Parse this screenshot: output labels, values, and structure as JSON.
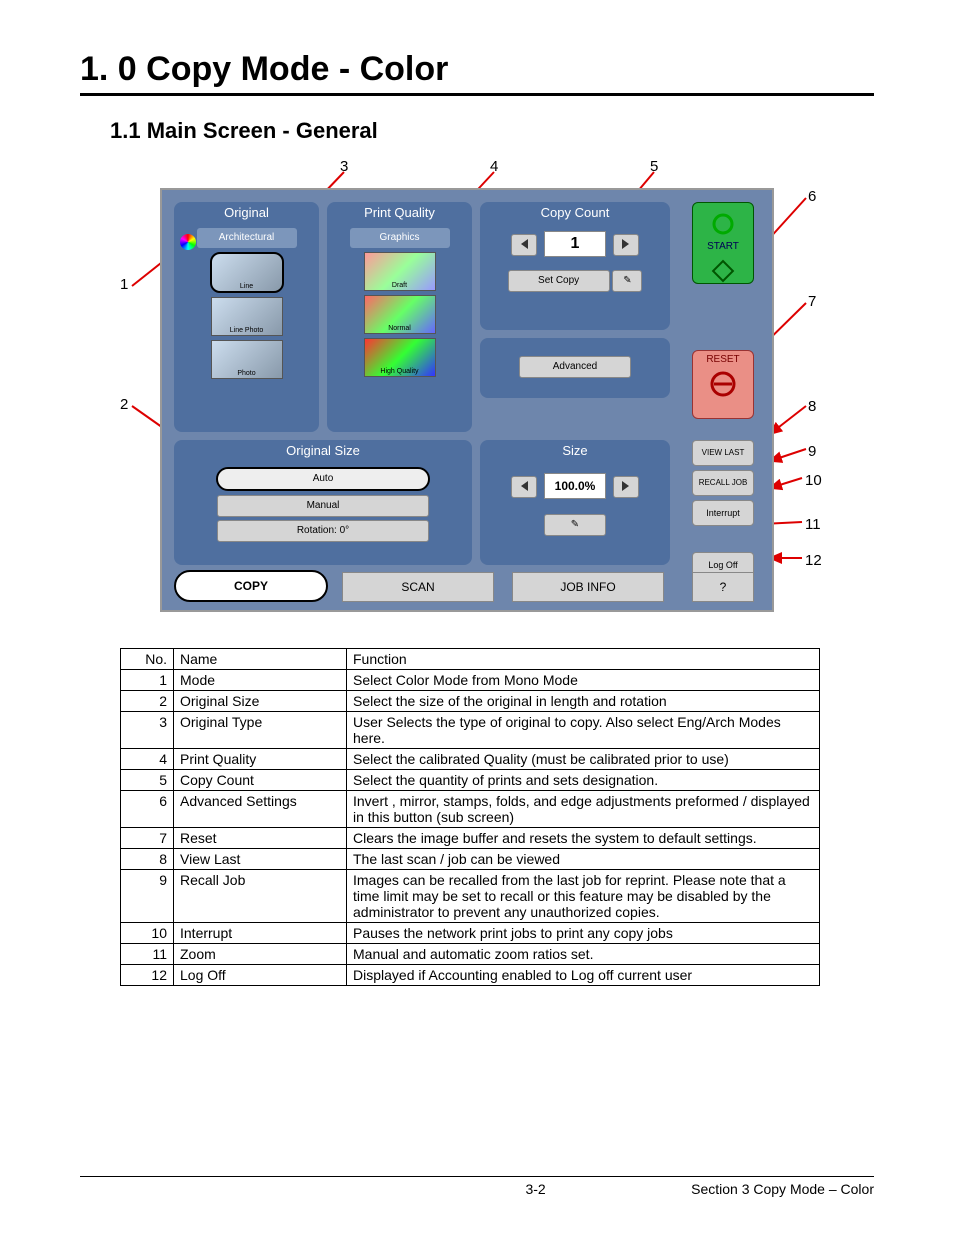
{
  "heading": {
    "h1": "1. 0    Copy Mode - Color",
    "h2": "1.1  Main Screen - General"
  },
  "screen": {
    "original": {
      "title": "Original",
      "sub": "Architectural",
      "types": [
        "Line",
        "Line Photo",
        "Photo"
      ]
    },
    "print_quality": {
      "title": "Print Quality",
      "sub": "Graphics",
      "levels": [
        "Draft",
        "Normal",
        "High Quality"
      ]
    },
    "copy_count": {
      "title": "Copy Count",
      "value": "1",
      "set": "Set Copy",
      "advanced": "Advanced"
    },
    "original_size": {
      "title": "Original Size",
      "auto": "Auto",
      "manual": "Manual",
      "rotation": "Rotation: 0°"
    },
    "size": {
      "title": "Size",
      "value": "100.0%"
    },
    "side": {
      "start": "START",
      "reset": "RESET",
      "viewlast": "VIEW LAST",
      "recall": "RECALL JOB",
      "interrupt": "Interrupt",
      "logoff": "Log Off",
      "help": "?"
    },
    "tabs": {
      "copy": "COPY",
      "scan": "SCAN",
      "jobinfo": "JOB INFO"
    }
  },
  "callouts": [
    "1",
    "2",
    "3",
    "4",
    "5",
    "6",
    "7",
    "8",
    "9",
    "10",
    "11",
    "12"
  ],
  "table": {
    "head": [
      "No.",
      "Name",
      "Function"
    ],
    "rows": [
      [
        "1",
        "Mode",
        "Select Color Mode from Mono Mode"
      ],
      [
        "2",
        "Original Size",
        "Select the size of the original in length and rotation"
      ],
      [
        "3",
        "Original Type",
        "User Selects the type of original to copy. Also select Eng/Arch Modes here."
      ],
      [
        "4",
        "Print Quality",
        "Select the calibrated Quality (must be calibrated prior to use)"
      ],
      [
        "5",
        "Copy Count",
        "Select the quantity of prints and sets designation."
      ],
      [
        "6",
        "Advanced Settings",
        "Invert , mirror, stamps, folds, and edge adjustments preformed / displayed in this button (sub screen)"
      ],
      [
        "7",
        "Reset",
        "Clears the image buffer and resets the system to default settings."
      ],
      [
        "8",
        "View Last",
        "The last scan / job can be viewed"
      ],
      [
        "9",
        "Recall Job",
        "Images can be recalled from the last job for reprint. Please note that a time limit may be set to recall or this feature may be disabled by the administrator to prevent any unauthorized copies."
      ],
      [
        "10",
        "Interrupt",
        "Pauses the network print jobs to print any copy jobs"
      ],
      [
        "11",
        "Zoom",
        "Manual and automatic zoom ratios set."
      ],
      [
        "12",
        "Log Off",
        "Displayed if Accounting enabled to Log off current user"
      ]
    ]
  },
  "footer": {
    "page": "3-2",
    "section": "Section 3    Copy Mode – Color"
  }
}
